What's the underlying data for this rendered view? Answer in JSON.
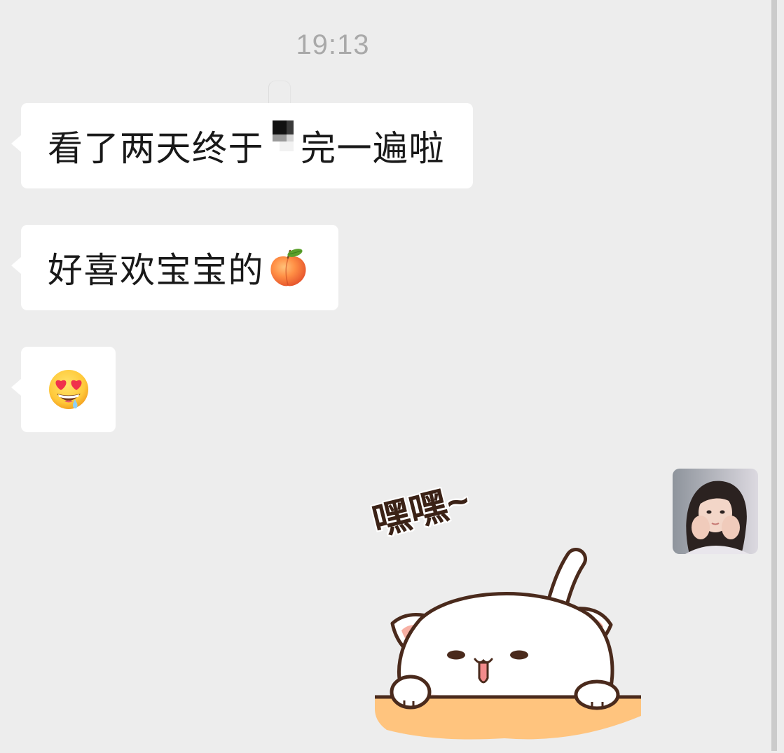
{
  "chat": {
    "timestamp": "19:13",
    "received": [
      {
        "text_before": "看了两天终于",
        "redaction_icon": "mosaic-redaction",
        "text_after": "完一遍啦"
      },
      {
        "text": "好喜欢宝宝的",
        "emoji_icon": "peach-emoji"
      },
      {
        "emoji_icon": "heart-eyes-drooling-face-emoji"
      }
    ],
    "sent": [
      {
        "avatar_icon": "user-avatar-photo",
        "sticker_icon": "white-cat-peeking-sticker",
        "sticker_text": "嘿嘿~"
      }
    ]
  },
  "colors": {
    "background": "#ededed",
    "bubble": "#ffffff",
    "text": "#191919",
    "timestamp": "#a9a9a9",
    "sticker_ledge": "#ffc47e",
    "sticker_outline": "#4a2a1c"
  }
}
